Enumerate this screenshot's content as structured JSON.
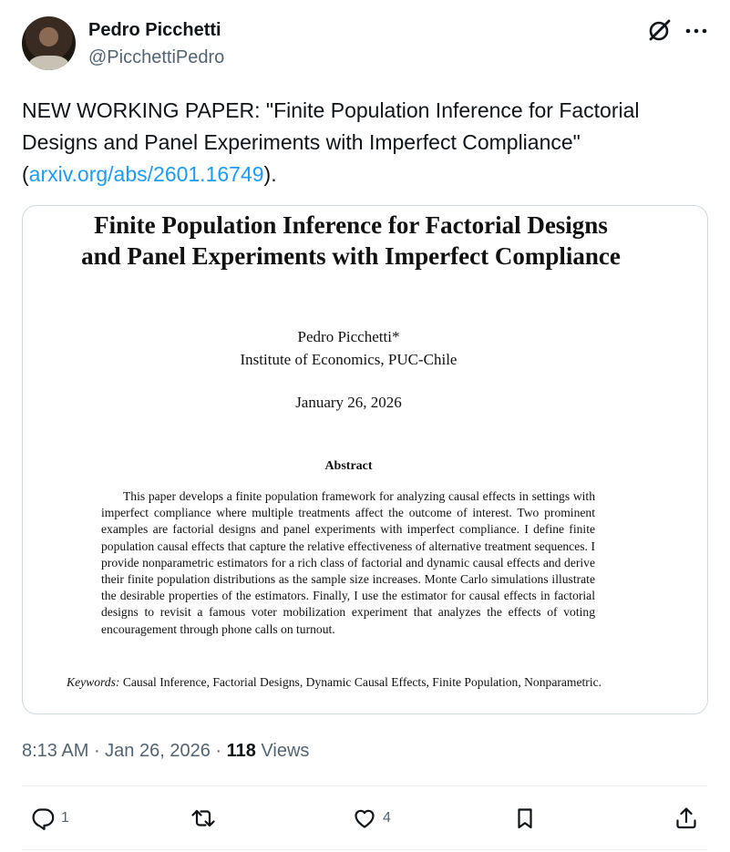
{
  "author": {
    "name": "Pedro Picchetti",
    "handle": "@PicchettiPedro"
  },
  "tweet": {
    "text_main": "NEW WORKING PAPER: \"Finite Population Inference for Factorial Designs and Panel Experiments with Imperfect Compliance\" (",
    "link": "arxiv.org/abs/2601.16749",
    "text_end": ")."
  },
  "paper": {
    "title": "Finite Population Inference for Factorial Designs and Panel Experiments with Imperfect Compliance",
    "author": "Pedro Picchetti*",
    "affiliation": "Institute of Economics, PUC-Chile",
    "date": "January 26, 2026",
    "abstract_heading": "Abstract",
    "abstract": "This paper develops a finite population framework for analyzing causal effects in settings with imperfect compliance where multiple treatments affect the outcome of interest. Two prominent examples are factorial designs and panel experiments with imperfect compliance. I define finite population causal effects that capture the relative effectiveness of alternative treatment sequences. I provide nonparametric estimators for a rich class of factorial and dynamic causal effects and derive their finite population distributions as the sample size increases. Monte Carlo simulations illustrate the desirable properties of the estimators. Finally, I use the estimator for causal effects in factorial designs to revisit a famous voter mobilization experiment that analyzes the effects of voting encouragement through phone calls on turnout.",
    "keywords_label": "Keywords:",
    "keywords": "Causal Inference, Factorial Designs, Dynamic Causal Effects, Finite Population, Nonparametric."
  },
  "meta": {
    "time": "8:13 AM",
    "separator1": " · ",
    "date": "Jan 26, 2026",
    "separator2": " · ",
    "views_count": "118",
    "views_label": " Views"
  },
  "actions": {
    "reply_count": "1",
    "retweet_count": "",
    "like_count": "4"
  },
  "icons": {
    "grok": "grok-icon",
    "more": "more-horizontal-icon",
    "reply": "reply-icon",
    "retweet": "retweet-icon",
    "like": "heart-icon",
    "bookmark": "bookmark-icon",
    "share": "share-icon"
  },
  "colors": {
    "text": "#0f1419",
    "secondary": "#536471",
    "link": "#1d9bf0",
    "border": "#cfd9de"
  }
}
